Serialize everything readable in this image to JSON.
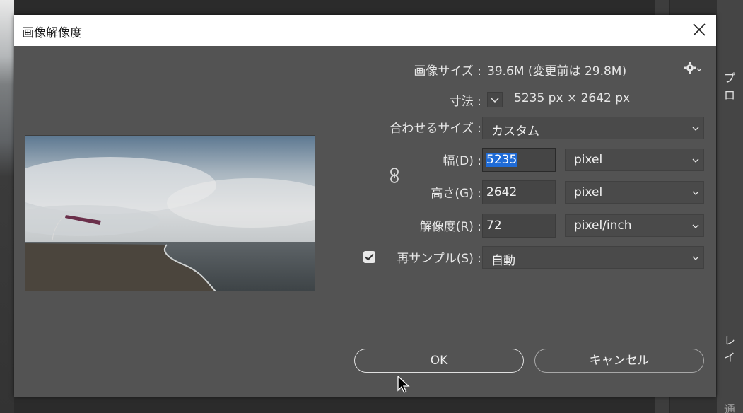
{
  "dialog": {
    "title": "画像解像度",
    "image_size_label": "画像サイズ :",
    "image_size_value": "39.6M (変更前は 29.8M)",
    "dimensions_label": "寸法 :",
    "dimensions_value": "5235 px × 2642 px",
    "fit_to_label": "合わせるサイズ :",
    "fit_to_value": "カスタム",
    "width_label": "幅(D) :",
    "width_value": "5235",
    "width_unit": "pixel",
    "height_label": "高さ(G) :",
    "height_value": "2642",
    "height_unit": "pixel",
    "resolution_label": "解像度(R) :",
    "resolution_value": "72",
    "resolution_unit": "pixel/inch",
    "resample_label": "再サンプル(S) :",
    "resample_checked": true,
    "resample_value": "自動",
    "ok_label": "OK",
    "cancel_label": "キャンセル"
  },
  "background_panel": {
    "item_1": "プロ",
    "item_2": "レイ",
    "item_3": "通"
  },
  "icons": {
    "close": "close-icon",
    "gear": "gear-icon",
    "link": "chain-link-icon",
    "chevron": "chevron-down-icon",
    "cursor": "mouse-pointer-icon"
  },
  "colors": {
    "dialog_bg": "#535353",
    "selection": "#1f6bd6",
    "titlebar": "#ffffff"
  }
}
